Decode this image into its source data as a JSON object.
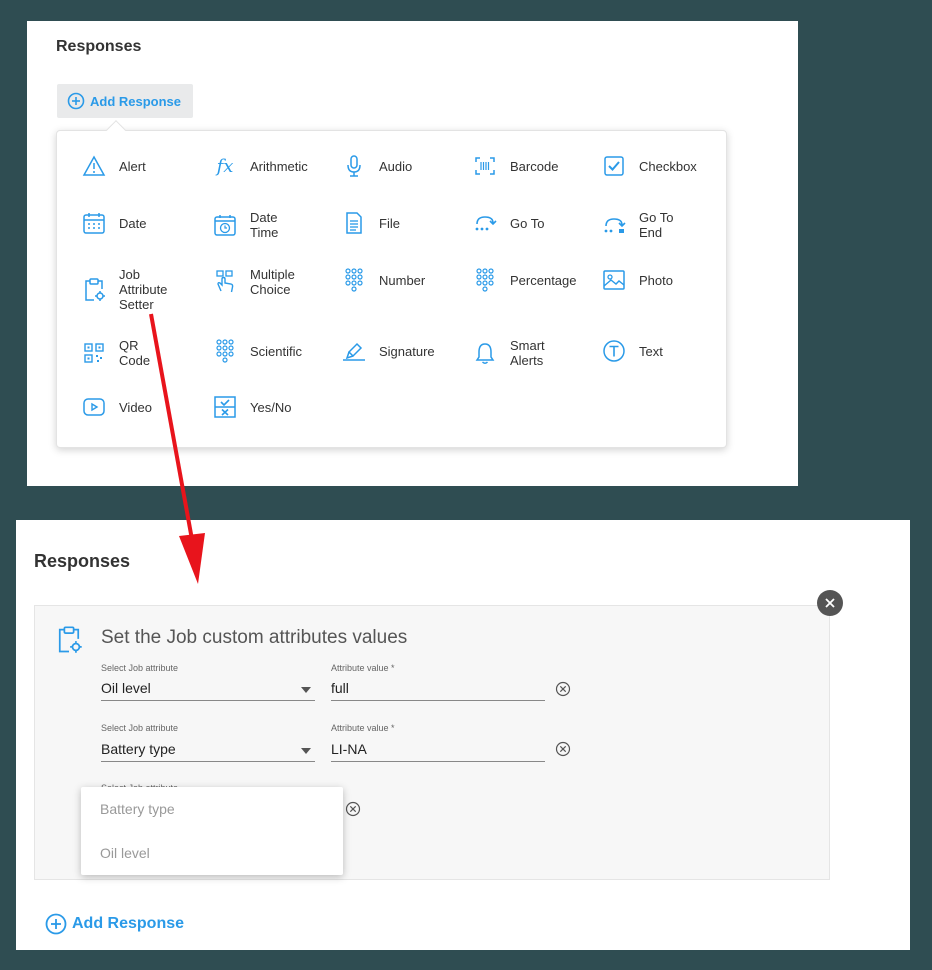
{
  "top_panel": {
    "title": "Responses",
    "add_response_label": "Add Response",
    "menu_items": [
      {
        "label": "Alert",
        "icon": "alert-icon"
      },
      {
        "label": "Arithmetic",
        "icon": "function-icon"
      },
      {
        "label": "Audio",
        "icon": "microphone-icon"
      },
      {
        "label": "Barcode",
        "icon": "barcode-icon"
      },
      {
        "label": "Checkbox",
        "icon": "checkbox-icon"
      },
      {
        "label": "Date",
        "icon": "calendar-icon"
      },
      {
        "label": "Date Time",
        "icon": "calendar-clock-icon"
      },
      {
        "label": "File",
        "icon": "file-icon"
      },
      {
        "label": "Go To",
        "icon": "goto-icon"
      },
      {
        "label": "Go To End",
        "icon": "goto-end-icon"
      },
      {
        "label": "Job Attribute Setter",
        "icon": "clipboard-gear-icon"
      },
      {
        "label": "Multiple Choice",
        "icon": "hand-pointer-icon"
      },
      {
        "label": "Number",
        "icon": "keypad-icon"
      },
      {
        "label": "Percentage",
        "icon": "keypad-icon"
      },
      {
        "label": "Photo",
        "icon": "image-icon"
      },
      {
        "label": "QR Code",
        "icon": "qr-code-icon"
      },
      {
        "label": "Scientific",
        "icon": "keypad-icon"
      },
      {
        "label": "Signature",
        "icon": "signature-icon"
      },
      {
        "label": "Smart Alerts",
        "icon": "bell-icon"
      },
      {
        "label": "Text",
        "icon": "text-icon"
      },
      {
        "label": "Video",
        "icon": "video-icon"
      },
      {
        "label": "Yes/No",
        "icon": "yes-no-icon"
      }
    ]
  },
  "bottom_panel": {
    "title": "Responses",
    "card_title": "Set the Job custom attributes values",
    "rows": [
      {
        "select_label": "Select Job attribute",
        "select_value": "Oil level",
        "value_label": "Attribute value *",
        "value": "full"
      },
      {
        "select_label": "Select Job attribute",
        "select_value": "Battery type",
        "value_label": "Attribute value *",
        "value": "LI-NA"
      }
    ],
    "third_row_label": "Select Job attribute",
    "dropdown_options": [
      "Battery type",
      "Oil level"
    ],
    "add_response_label": "Add Response"
  },
  "colors": {
    "accent": "#2a9ae8",
    "background": "#2f4d52",
    "arrow": "#e8141c"
  }
}
